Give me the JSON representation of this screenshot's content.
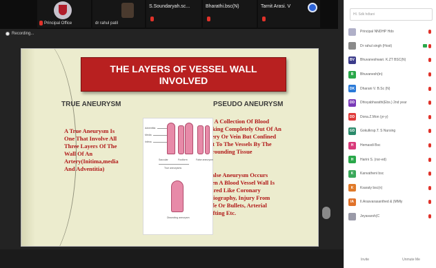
{
  "meeting": {
    "recording_label": "Recording...",
    "tiles": [
      {
        "name": "Principal Office"
      },
      {
        "name": "dr rahul patil"
      },
      {
        "name": "S.Soundaryah.sc..."
      },
      {
        "name": "Bharathi.bsc(N)"
      },
      {
        "name": "Tarnit Arasi. V"
      }
    ]
  },
  "slide": {
    "title_line1": "THE LAYERS OF VESSEL WALL",
    "title_line2": "INVOLVED",
    "left_heading": "TRUE ANEURYSM",
    "right_heading": "PSEUDO ANEURYSM",
    "left_text": [
      "A True Aneurysm Is",
      "One That Involve All",
      "Three Layers Of The",
      "Wall Of An",
      "Artery(Initima,media",
      "And Adventitia)"
    ],
    "bullet1": [
      "It Is A Collection Of Blood",
      "Leaking Completely Out Of An",
      "Artery Or Vein  But Confined",
      "Next To The Vessels By The",
      "Surrounding Tissue"
    ],
    "bullet2": [
      "A False Aneurysm Occurs",
      "When A Blood Vessel Wall Is",
      "Injured Like Coronary",
      "Angiography, Injury From",
      "Knife Or Bullets, Arterial",
      "Grafting Etc."
    ],
    "diagram_labels": {
      "adventitia": "Adventitia",
      "media": "Media",
      "intima": "Intima",
      "saccular": "Saccular",
      "fusiform": "Fusiform",
      "false": "False aneurysm",
      "true_aneurysms": "True aneurysms",
      "dissecting": "Dissecting aneurysm"
    }
  },
  "sidebar": {
    "search_placeholder": "Hl. Sdk hdtani",
    "participants": [
      {
        "initials": "",
        "name": "Principal NNDHP Hdo",
        "color": "#b0b0c8",
        "cam": false
      },
      {
        "initials": "",
        "name": "Dr rahul singh (Host)",
        "color": "#8a8a8a",
        "cam": true
      },
      {
        "initials": "BV",
        "name": "Bhuvaneshwari. K.ZT BSC(N)",
        "color": "#3b3b8a",
        "cam": false
      },
      {
        "initials": "B",
        "name": "Bhuvanesh(tn)",
        "color": "#2aa84a",
        "cam": false
      },
      {
        "initials": "DK",
        "name": "Dharani V. B.Sc (N)",
        "color": "#2a7ad8",
        "cam": false
      },
      {
        "initials": "DD",
        "name": "Dhivyabharathi(Ebs.) 2nd year",
        "color": "#7a3ab8",
        "cam": false
      },
      {
        "initials": "DD",
        "name": "Dona.Z.Mon (yr-y)",
        "color": "#e03a3a",
        "cam": false
      },
      {
        "initials": "GD",
        "name": "Gokulkrsp.T. S Nursing",
        "color": "#2a8a6a",
        "cam": false
      },
      {
        "initials": "H",
        "name": "Hemasdi Bsc",
        "color": "#d83a7a",
        "cam": false
      },
      {
        "initials": "H",
        "name": "Harini S. (nsr-ed)",
        "color": "#2aa84a",
        "cam": false
      },
      {
        "initials": "K",
        "name": "Kanvatheni bsc",
        "color": "#3aa85a",
        "cam": false
      },
      {
        "initials": "K",
        "name": "Ksaraty bsc(n)",
        "color": "#e07a2a",
        "cam": false
      },
      {
        "initials": "IA",
        "name": "Il.Arasvarasanthed & (MMly",
        "color": "#e0722a",
        "cam": false
      },
      {
        "initials": "",
        "name": "Jeyavarsh(C",
        "color": "#9a9aa8",
        "cam": false
      }
    ],
    "footer": {
      "invite": "Invite",
      "unmute": "Unmute Me"
    }
  }
}
